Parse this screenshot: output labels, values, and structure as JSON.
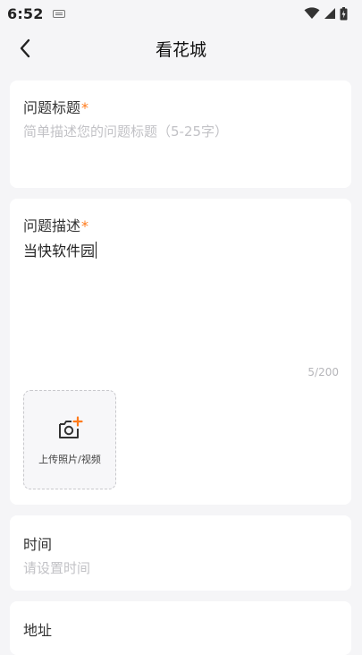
{
  "status_bar": {
    "time": "6:52"
  },
  "header": {
    "title": "看花城"
  },
  "form": {
    "title_field": {
      "label": "问题标题",
      "required_mark": "*",
      "placeholder": "简单描述您的问题标题（5-25字）"
    },
    "description_field": {
      "label": "问题描述",
      "required_mark": "*",
      "value": "当快软件园",
      "counter": "5/200"
    },
    "upload": {
      "label": "上传照片/视频"
    },
    "time_field": {
      "label": "时间",
      "placeholder": "请设置时间"
    },
    "address_field": {
      "label": "地址"
    }
  },
  "colors": {
    "background": "#f5f5f7",
    "card": "#ffffff",
    "accent": "#ff7a1a",
    "placeholder": "#c2c2c6"
  },
  "icons": [
    "keyboard-icon",
    "wifi-icon",
    "signal-icon",
    "battery-icon",
    "back-arrow-icon",
    "add-photo-icon"
  ]
}
